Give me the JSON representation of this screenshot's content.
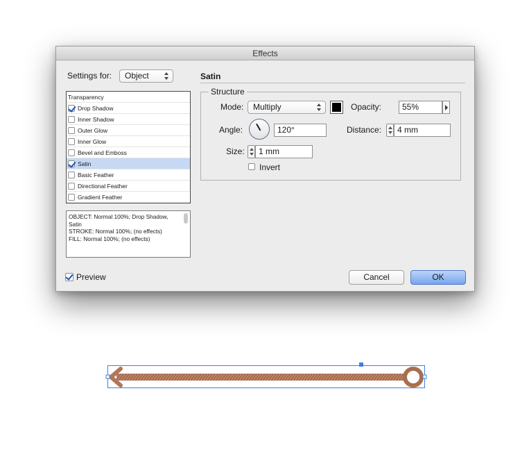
{
  "dialog": {
    "title": "Effects",
    "settings_for_label": "Settings for:",
    "settings_for_value": "Object",
    "effects_list": [
      {
        "label": "Transparency",
        "checked": null,
        "selected": false
      },
      {
        "label": "Drop Shadow",
        "checked": true,
        "selected": false
      },
      {
        "label": "Inner Shadow",
        "checked": false,
        "selected": false
      },
      {
        "label": "Outer Glow",
        "checked": false,
        "selected": false
      },
      {
        "label": "Inner Glow",
        "checked": false,
        "selected": false
      },
      {
        "label": "Bevel and Emboss",
        "checked": false,
        "selected": false
      },
      {
        "label": "Satin",
        "checked": true,
        "selected": true
      },
      {
        "label": "Basic Feather",
        "checked": false,
        "selected": false
      },
      {
        "label": "Directional Feather",
        "checked": false,
        "selected": false
      },
      {
        "label": "Gradient Feather",
        "checked": false,
        "selected": false
      }
    ],
    "summary": [
      "OBJECT: Normal 100%; Drop Shadow, Satin",
      "STROKE: Normal 100%; (no effects)",
      "FILL: Normal 100%; (no effects)"
    ],
    "preview_label": "Preview",
    "preview_checked": true,
    "cancel_label": "Cancel",
    "ok_label": "OK",
    "panel": {
      "title": "Satin",
      "group_title": "Structure",
      "mode_label": "Mode:",
      "mode_value": "Multiply",
      "color": "#000000",
      "opacity_label": "Opacity:",
      "opacity_value": "55%",
      "angle_label": "Angle:",
      "angle_value": "120°",
      "distance_label": "Distance:",
      "distance_value": "4 mm",
      "size_label": "Size:",
      "size_value": "1 mm",
      "invert_label": "Invert",
      "invert_checked": false
    }
  },
  "artwork": {
    "stroke_color": "#b0765a",
    "selection_color": "#3d7fe0"
  }
}
